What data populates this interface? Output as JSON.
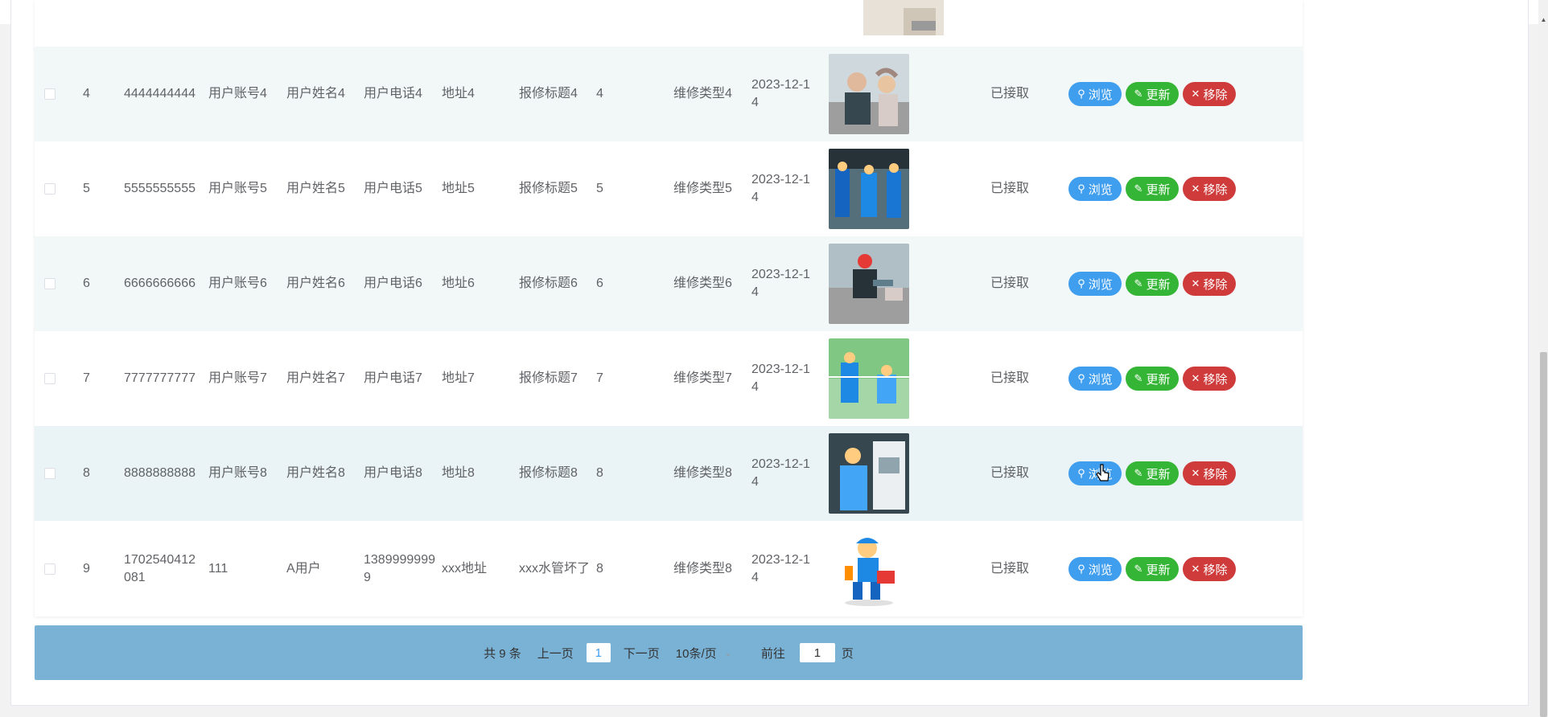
{
  "rows": [
    {
      "index": "4",
      "number": "4444444444",
      "account": "用户账号4",
      "name": "用户姓名4",
      "phone": "用户电话4",
      "address": "地址4",
      "title": "报修标题4",
      "quantity": "4",
      "type": "维修类型4",
      "date": "2023-12-14",
      "image": "technician-with-customer-photo",
      "status": "已接取"
    },
    {
      "index": "5",
      "number": "5555555555",
      "account": "用户账号5",
      "name": "用户姓名5",
      "phone": "用户电话5",
      "address": "地址5",
      "title": "报修标题5",
      "quantity": "5",
      "type": "维修类型5",
      "date": "2023-12-14",
      "image": "workers-in-factory-photo",
      "status": "已接取"
    },
    {
      "index": "6",
      "number": "6666666666",
      "account": "用户账号6",
      "name": "用户姓名6",
      "phone": "用户电话6",
      "address": "地址6",
      "title": "报修标题6",
      "quantity": "6",
      "type": "维修类型6",
      "date": "2023-12-14",
      "image": "worker-repairing-road-photo",
      "status": "已接取"
    },
    {
      "index": "7",
      "number": "7777777777",
      "account": "用户账号7",
      "name": "用户姓名7",
      "phone": "用户电话7",
      "address": "地址7",
      "title": "报修标题7",
      "quantity": "7",
      "type": "维修类型7",
      "date": "2023-12-14",
      "image": "workers-outdoor-photo",
      "status": "已接取"
    },
    {
      "index": "8",
      "number": "8888888888",
      "account": "用户账号8",
      "name": "用户姓名8",
      "phone": "用户电话8",
      "address": "地址8",
      "title": "报修标题8",
      "quantity": "8",
      "type": "维修类型8",
      "date": "2023-12-14",
      "image": "technician-at-panel-photo",
      "status": "已接取"
    },
    {
      "index": "9",
      "number": "1702540412081",
      "account": "111",
      "name": "A用户",
      "phone": "13899999999",
      "address": "xxx地址",
      "title": "xxx水管坏了",
      "quantity": "8",
      "type": "维修类型8",
      "date": "2023-12-14",
      "image": "cartoon-plumber-illustration",
      "status": "已接取"
    }
  ],
  "actions": {
    "view": "浏览",
    "edit": "更新",
    "delete": "移除"
  },
  "icons": {
    "view": "search-icon",
    "edit": "edit-icon",
    "delete": "close-icon"
  },
  "pagination": {
    "total": "共 9 条",
    "prev": "上一页",
    "current_page": "1",
    "next": "下一页",
    "page_size": "10条/页",
    "goto_label": "前往",
    "goto_value": "1",
    "goto_suffix": "页"
  },
  "colors": {
    "view_button": "#409eef",
    "edit_button": "#35b535",
    "delete_button": "#cf3b3b",
    "pagination_bar": "#7ab2d6",
    "row_stripe": "#f2f8f8"
  }
}
